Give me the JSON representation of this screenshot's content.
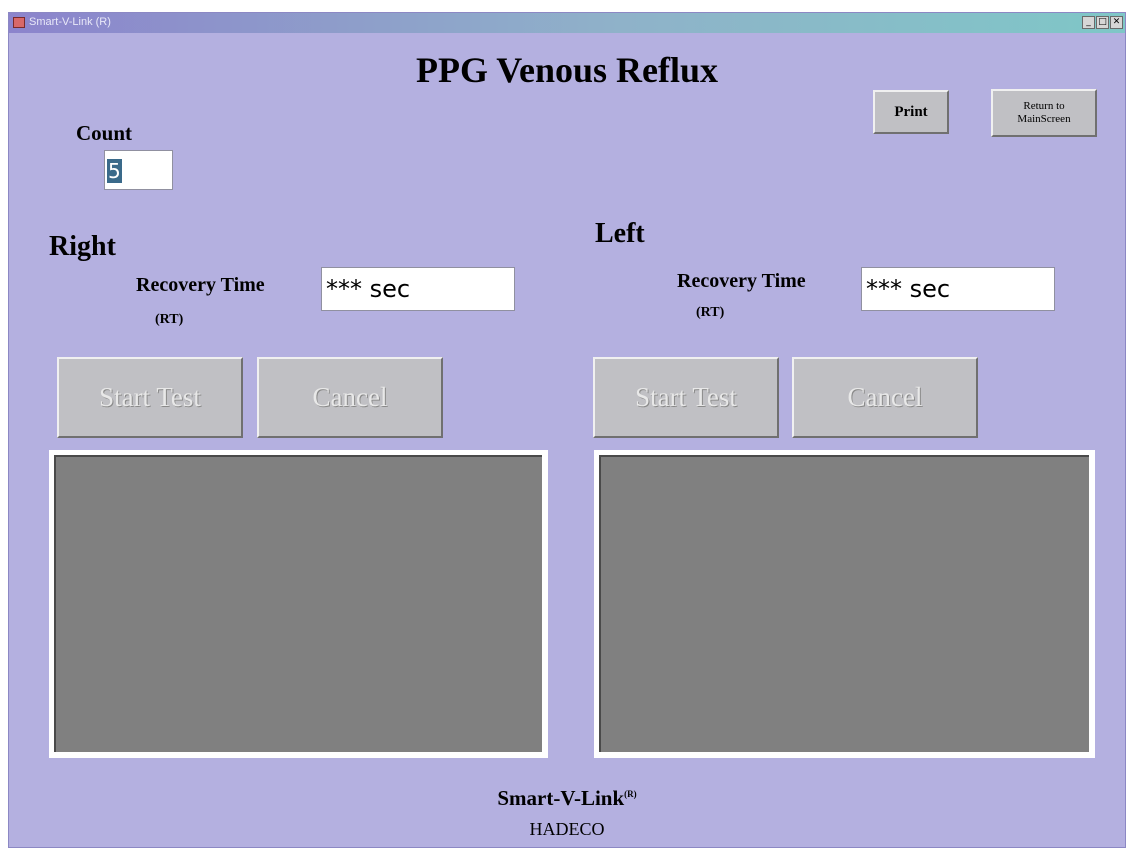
{
  "window": {
    "title": "Smart-V-Link (R)",
    "controls": {
      "minimize": "_",
      "maximize": "□",
      "close": "✕"
    }
  },
  "header": {
    "title": "PPG Venous Reflux"
  },
  "toolbar": {
    "print_label": "Print",
    "return_label_line1": "Return to",
    "return_label_line2": "MainScreen"
  },
  "count": {
    "label": "Count",
    "value": "5"
  },
  "right": {
    "heading": "Right",
    "recovery_label": "Recovery Time",
    "rt_label": "(RT)",
    "recovery_value": "*** sec",
    "start_label": "Start Test",
    "cancel_label": "Cancel"
  },
  "left": {
    "heading": "Left",
    "recovery_label": "Recovery Time",
    "rt_label": "(RT)",
    "recovery_value": "*** sec",
    "start_label": "Start Test",
    "cancel_label": "Cancel"
  },
  "footer": {
    "brand": "Smart-V-Link",
    "brand_mark": "(R)",
    "company": "HADECO"
  },
  "colors": {
    "background": "#b4b0e0",
    "graph_background": "#808080",
    "button_face": "#c0c0c4"
  }
}
